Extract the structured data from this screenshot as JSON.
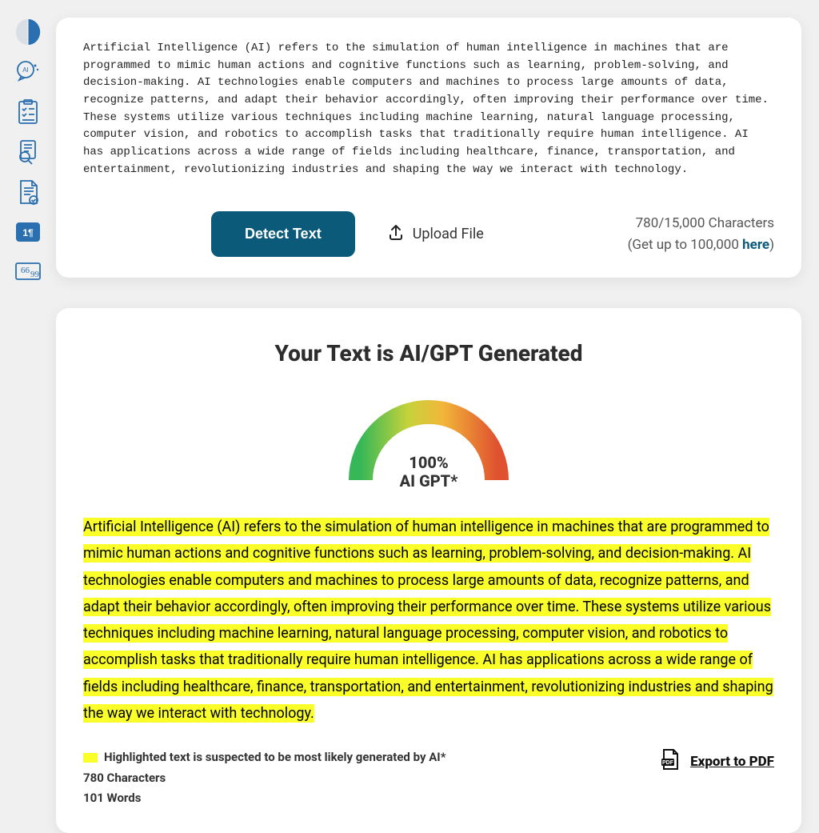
{
  "sidebar": {
    "items": [
      {
        "name": "brain-logo-icon"
      },
      {
        "name": "ai-chat-icon"
      },
      {
        "name": "checklist-icon"
      },
      {
        "name": "search-doc-icon"
      },
      {
        "name": "doc-check-icon"
      },
      {
        "name": "word-count-icon"
      },
      {
        "name": "quote-icon"
      }
    ]
  },
  "editor": {
    "input_text": "Artificial Intelligence (AI) refers to the simulation of human intelligence in machines that are programmed to mimic human actions and cognitive functions such as learning, problem-solving, and decision-making. AI technologies enable computers and machines to process large amounts of data, recognize patterns, and adapt their behavior accordingly, often improving their performance over time. These systems utilize various techniques including machine learning, natural language processing, computer vision, and robotics to accomplish tasks that traditionally require human intelligence. AI has applications across a wide range of fields including healthcare, finance, transportation, and entertainment, revolutionizing industries and shaping the way we interact with technology.",
    "detect_label": "Detect Text",
    "upload_label": "Upload File",
    "char_counter": "780/15,000 Characters",
    "upsell_prefix": "(Get up to 100,000 ",
    "upsell_link": "here",
    "upsell_suffix": ")"
  },
  "results": {
    "title": "Your Text is AI/GPT Generated",
    "gauge_percent": "100%",
    "gauge_sublabel": "AI GPT*",
    "highlighted_text": "Artificial Intelligence (AI) refers to the simulation of human intelligence in machines that are programmed to mimic human actions and cognitive functions such as learning, problem-solving, and decision-making. AI technologies enable computers and machines to process large amounts of data, recognize patterns, and adapt their behavior accordingly, often improving their performance over time. These systems utilize various techniques including machine learning, natural language processing, computer vision, and robotics to accomplish tasks that traditionally require human intelligence. AI has applications across a wide range of fields including healthcare, finance, transportation, and entertainment, revolutionizing industries and shaping the way we interact with technology.",
    "legend_text": "Highlighted text is suspected to be most likely generated by AI*",
    "char_count": "780 Characters",
    "word_count": "101 Words",
    "export_label": "Export to PDF"
  },
  "chart_data": {
    "type": "gauge",
    "title": "AI GPT*",
    "value": 100,
    "min": 0,
    "max": 100,
    "unit": "%",
    "label": "100% AI GPT*"
  }
}
